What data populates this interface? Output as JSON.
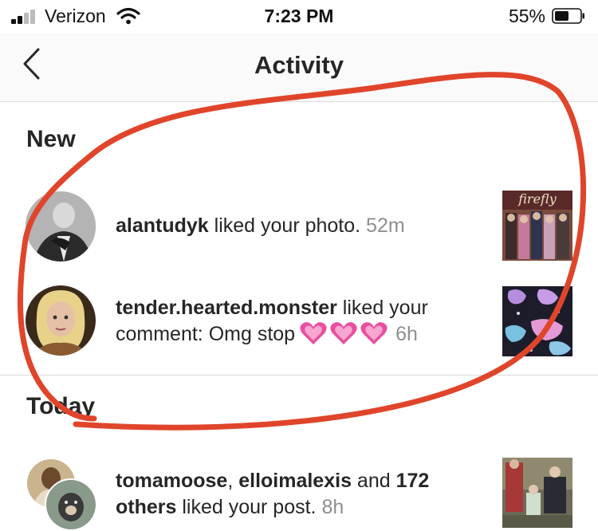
{
  "status_bar": {
    "carrier": "Verizon",
    "time": "7:23 PM",
    "battery": "55%"
  },
  "nav": {
    "title": "Activity"
  },
  "sections": {
    "new": {
      "header": "New",
      "items": [
        {
          "username": "alantudyk",
          "action": " liked your photo. ",
          "time": "52m"
        },
        {
          "username": "tender.hearted.monster",
          "action": " liked your comment: Omg stop",
          "time": "6h"
        }
      ]
    },
    "today": {
      "header": "Today",
      "items": [
        {
          "user1": "tomamoose",
          "sep": ", ",
          "user2": "elloimalexis",
          "and": " and ",
          "count": "172",
          "others": "others",
          "action": " liked your post. ",
          "time": "8h"
        }
      ]
    }
  },
  "colors": {
    "annotation": "#e0452b",
    "divider": "#dbdbdb",
    "timestamp": "#8e8e8e",
    "heart": "#e84fa0"
  },
  "thumbnail_text": {
    "firefly": "firefly"
  }
}
